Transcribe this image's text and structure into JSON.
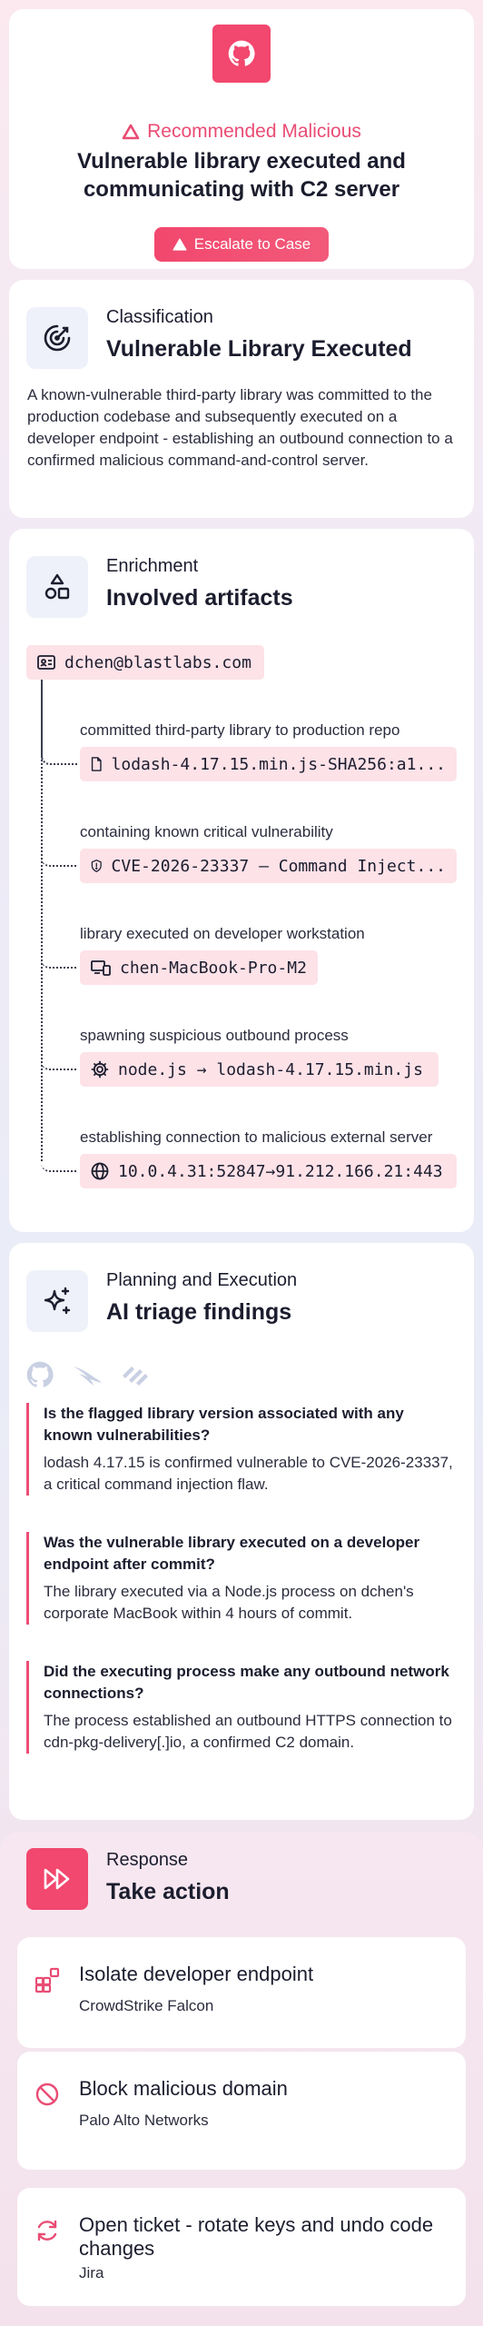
{
  "header": {
    "badge_label": "Recommended Malicious",
    "title": "Vulnerable library executed and communicating with C2 server",
    "escalate_label": "Escalate to Case",
    "logo_icon": "github-icon"
  },
  "classification": {
    "eyebrow": "Classification",
    "title": "Vulnerable Library Executed",
    "body": "A known-vulnerable third-party library was committed to the production codebase and subsequently executed on a developer endpoint - establishing an outbound connection to a confirmed malicious command-and-control server.",
    "icon": "target-icon"
  },
  "enrichment": {
    "eyebrow": "Enrichment",
    "title": "Involved artifacts",
    "icon": "shapes-icon",
    "root_artifact": {
      "icon": "id-card-icon",
      "value": "dchen@blastlabs.com"
    },
    "artifacts": [
      {
        "description": "committed third-party library to production repo",
        "icon": "file-icon",
        "value": "lodash-4.17.15.min.js-SHA256:a1..."
      },
      {
        "description": "containing known critical vulnerability",
        "icon": "shield-alert-icon",
        "value": "CVE-2026-23337 — Command Inject..."
      },
      {
        "description": "library executed on developer workstation",
        "icon": "devices-icon",
        "value": "chen-MacBook-Pro-M2"
      },
      {
        "description": "spawning suspicious outbound process",
        "icon": "gear-icon",
        "value": "node.js → lodash-4.17.15.min.js"
      },
      {
        "description": "establishing connection to malicious external server",
        "icon": "globe-icon",
        "value": "10.0.4.31:52847→91.212.166.21:443"
      }
    ]
  },
  "planning": {
    "eyebrow": "Planning and Execution",
    "title": "AI triage findings",
    "icon": "sparkles-icon",
    "vendor_icons": [
      "github-icon",
      "crowdstrike-icon",
      "paloalto-icon"
    ],
    "findings": [
      {
        "question": "Is the flagged library version associated with any known vulnerabilities?",
        "answer": "lodash 4.17.15 is confirmed vulnerable to CVE-2026-23337, a critical command injection flaw."
      },
      {
        "question": "Was the vulnerable library executed on a developer endpoint after commit?",
        "answer": "The library executed via a Node.js process on dchen's corporate MacBook within 4 hours of commit."
      },
      {
        "question": "Did the executing process make any outbound network connections?",
        "answer": "The process established an outbound HTTPS connection to cdn-pkg-delivery[.]io, a confirmed C2 domain."
      }
    ]
  },
  "response": {
    "eyebrow": "Response",
    "title": "Take action",
    "icon": "fast-forward-icon",
    "actions": [
      {
        "title": "Isolate developer endpoint",
        "vendor": "CrowdStrike Falcon",
        "icon": "isolate-icon"
      },
      {
        "title": "Block malicious domain",
        "vendor": "Palo Alto Networks",
        "icon": "block-icon"
      },
      {
        "title": "Open ticket - rotate keys and undo code changes",
        "vendor": "Jira",
        "icon": "refresh-icon"
      }
    ]
  },
  "colors": {
    "accent": "#f2476e",
    "chip": "#fde2e8",
    "icon_tile": "#eef1f9"
  }
}
